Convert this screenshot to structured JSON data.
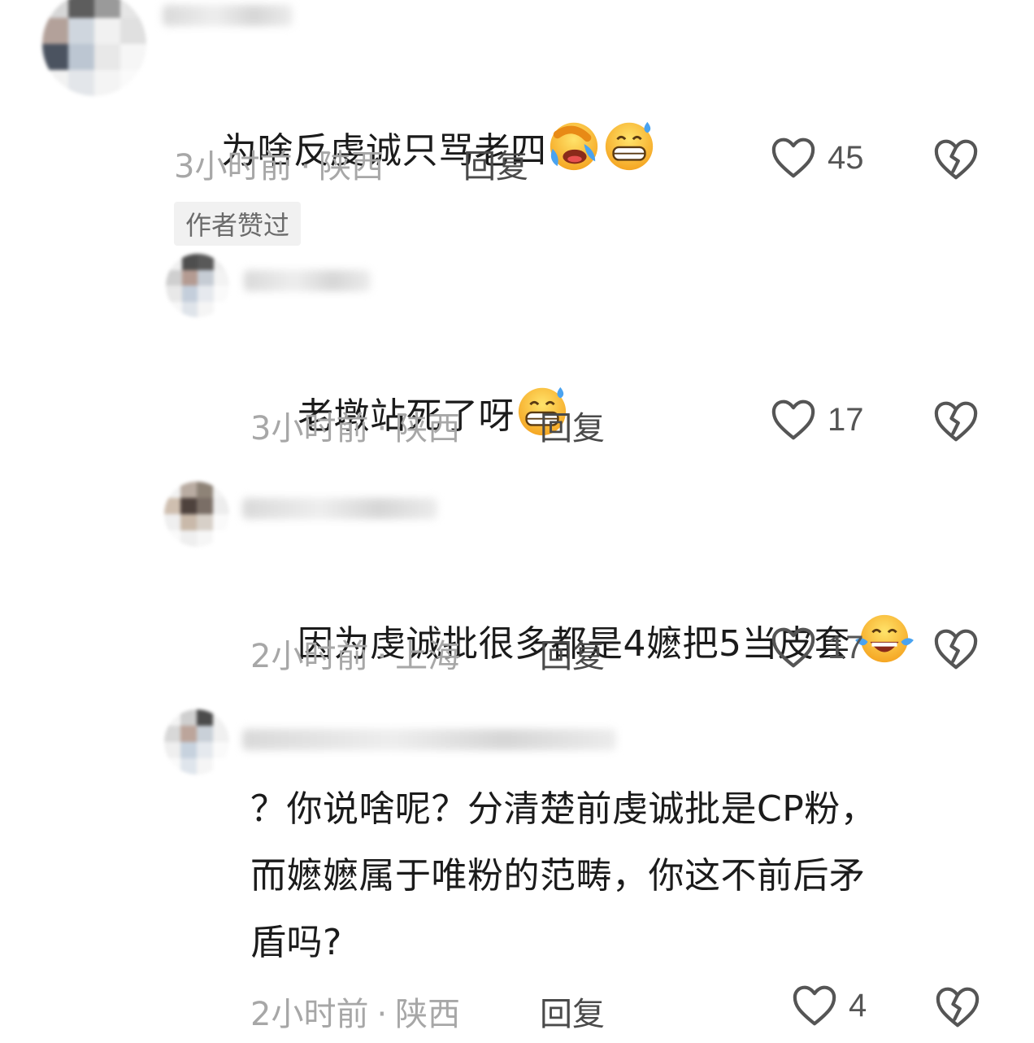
{
  "comments": [
    {
      "text": "为啥反虔诚只骂老四",
      "emojis": [
        "facepalm-cry-emoji",
        "sweat-grin-emoji"
      ],
      "time": "3小时前",
      "location": "陕西",
      "reply_label": "回复",
      "likes": "45",
      "badge": "作者赞过"
    },
    {
      "text": "老墩站死了呀",
      "emojis": [
        "sweat-grin-emoji"
      ],
      "time": "3小时前",
      "location": "陕西",
      "reply_label": "回复",
      "likes": "17"
    },
    {
      "text": "因为虔诚批很多都是4嬷把5当皮套",
      "emojis": [
        "tears-of-joy-emoji"
      ],
      "time": "2小时前",
      "location": "上海",
      "reply_label": "回复",
      "likes": "17"
    },
    {
      "text": "？你说啥呢？分清楚前虔诚批是CP粉，\n而嬷嬷属于唯粉的范畴，你这不前后矛\n盾吗?",
      "emojis": [],
      "time": "2小时前",
      "location": "陕西",
      "reply_label": "回复",
      "likes": "4"
    }
  ],
  "separator": "·",
  "colors": {
    "meta_gray": "#a7a7a7",
    "text": "#1b1b1b",
    "emoji_yellow": "#f9c02a"
  }
}
